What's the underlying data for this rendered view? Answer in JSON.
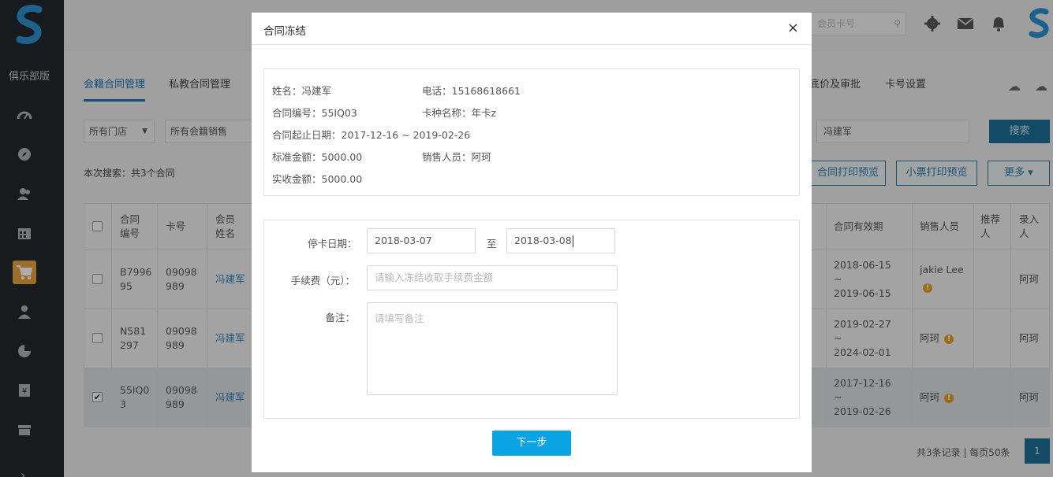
{
  "sidebar": {
    "club_label": "俱乐部版",
    "items": [
      {
        "icon": "dashboard-icon"
      },
      {
        "icon": "compass-icon"
      },
      {
        "icon": "members-icon"
      },
      {
        "icon": "calendar-icon"
      },
      {
        "icon": "cart-icon",
        "active": true
      },
      {
        "icon": "user-icon"
      },
      {
        "icon": "pie-chart-icon"
      },
      {
        "icon": "finance-icon"
      },
      {
        "icon": "store-icon"
      }
    ],
    "expand_icon": "chevron-right-icon"
  },
  "topbar": {
    "search_placeholder": "会员卡号"
  },
  "tabs": [
    "会籍合同管理",
    "私教合同管理",
    "底价及审批",
    "卡号设置"
  ],
  "filters": {
    "store": "所有门店",
    "sales": "所有会籍销售",
    "keyword": "冯建军",
    "search_button": "搜索"
  },
  "search_summary": "本次搜索：共3个合同",
  "actions": {
    "contract_print": "合同打印预览",
    "receipt_print": "小票打印预览",
    "more": "更多"
  },
  "table": {
    "headers": {
      "contract_no": "合同编号",
      "card_no": "卡号",
      "member_name": "会员姓名",
      "validity": "合同有效期",
      "sales": "销售人员",
      "referrer": "推荐人",
      "entry": "录入人"
    },
    "rows": [
      {
        "contract_no": "B7996 95",
        "card_no": "09098 989",
        "name": "冯建军",
        "validity_start": "2018-06-15",
        "validity_end": "2019-06-15",
        "sales": "jakie Lee",
        "entry": "阿珂",
        "selected": false
      },
      {
        "contract_no": "N581 297",
        "card_no": "09098 989",
        "name": "冯建军",
        "validity_start": "2019-02-27",
        "validity_end": "2024-02-01",
        "sales": "阿珂",
        "entry": "阿珂",
        "selected": false
      },
      {
        "contract_no": "55IQ0 3",
        "card_no": "09098 989",
        "name": "冯建军",
        "validity_start": "2017-12-16",
        "validity_end": "2019-02-26",
        "sales": "阿珂",
        "entry": "阿珂",
        "selected": true
      }
    ],
    "tilde": "~",
    "check_mark": "✔"
  },
  "footer": {
    "records": "共3条记录 | 每页50条",
    "page": "1"
  },
  "modal": {
    "title": "合同冻结",
    "close": "×",
    "info": {
      "name": "姓名：冯建军",
      "phone": "电话：15168618661",
      "contract_no": "合同编号：55IQ03",
      "card_type": "卡种名称：年卡z",
      "date_range": "合同起止日期：2017-12-16 ~ 2019-02-26",
      "standard_amount": "标准金额：5000.00",
      "sales": "销售人员：阿珂",
      "received_amount": "实收金额：5000.00"
    },
    "form": {
      "stop_date_label": "停卡日期：",
      "start_date": "2018-03-07",
      "to": "至",
      "end_date": "2018-03-08",
      "fee_label": "手续费（元）：",
      "fee_placeholder": "请输入冻结收取手续费金额",
      "remark_label": "备注：",
      "remark_placeholder": "请填写备注"
    },
    "next_button": "下一步"
  }
}
